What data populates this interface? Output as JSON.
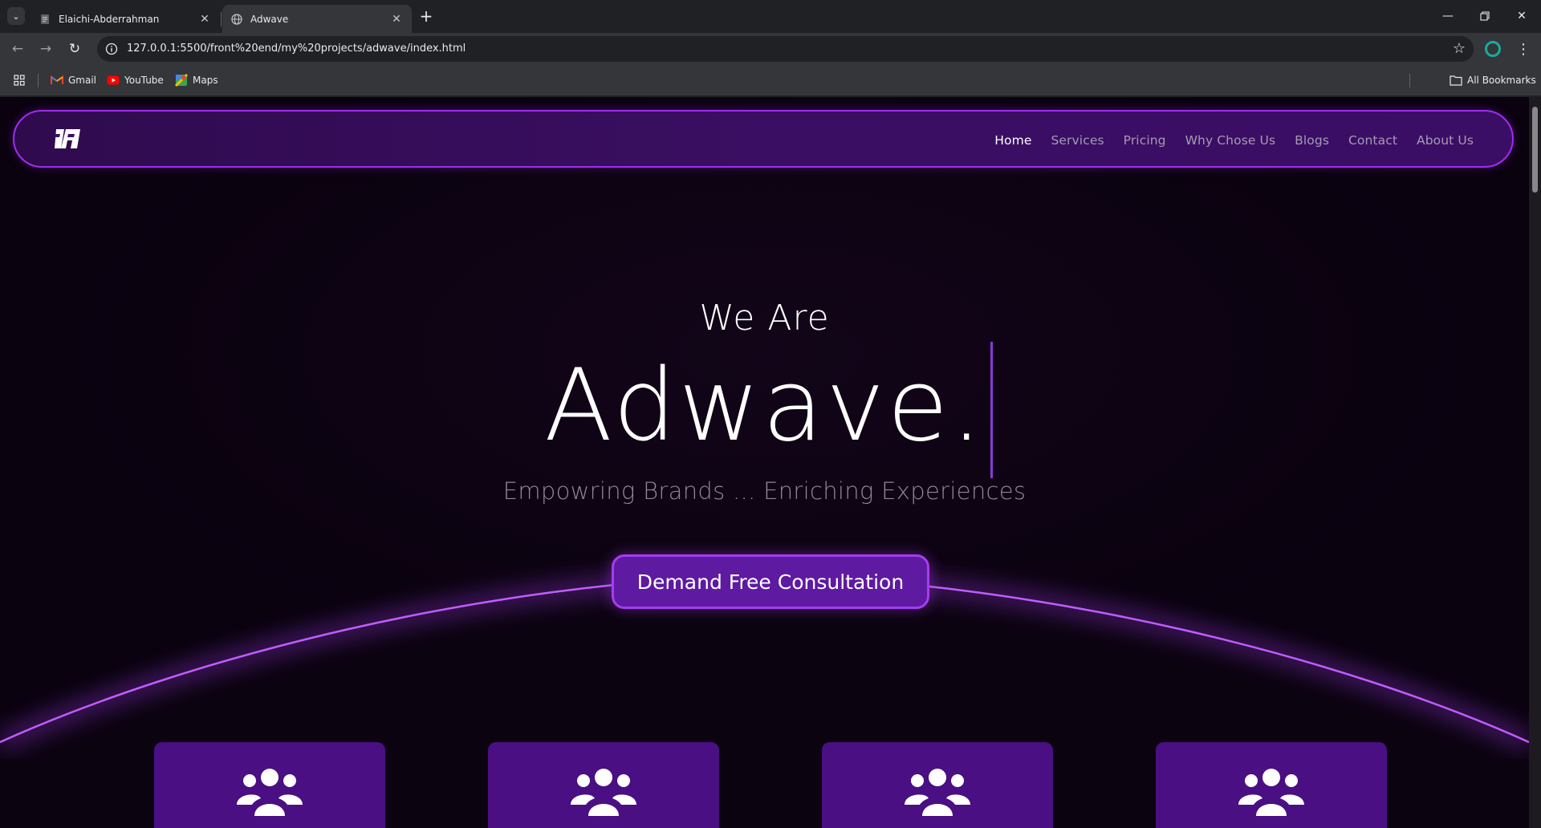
{
  "browser": {
    "tabs": [
      {
        "title": "Elaichi-Abderrahman",
        "active": false,
        "icon": "document-icon"
      },
      {
        "title": "Adwave",
        "active": true,
        "icon": "globe-icon"
      }
    ],
    "url": "127.0.0.1:5500/front%20end/my%20projects/adwave/index.html",
    "bookmarks": [
      {
        "label": "Gmail",
        "icon": "gmail-icon"
      },
      {
        "label": "YouTube",
        "icon": "youtube-icon"
      },
      {
        "label": "Maps",
        "icon": "maps-icon"
      }
    ],
    "all_bookmarks_label": "All Bookmarks"
  },
  "page": {
    "nav": {
      "links": [
        {
          "label": "Home",
          "active": true
        },
        {
          "label": "Services",
          "active": false
        },
        {
          "label": "Pricing",
          "active": false
        },
        {
          "label": "Why Chose Us",
          "active": false
        },
        {
          "label": "Blogs",
          "active": false
        },
        {
          "label": "Contact",
          "active": false
        },
        {
          "label": "About Us",
          "active": false
        }
      ]
    },
    "hero": {
      "small": "We Are",
      "big": "Adwave.",
      "subtitle": "Empowring Brands ... Enriching Experiences",
      "cta": "Demand Free Consultation"
    },
    "cards": [
      {
        "icon": "users-icon"
      },
      {
        "icon": "users-icon"
      },
      {
        "icon": "users-icon"
      },
      {
        "icon": "users-icon"
      }
    ]
  },
  "colors": {
    "accent": "#9f2cf0",
    "nav_bg": "#3a0e62",
    "card_bg": "#4a0f83",
    "cta_bg": "#5e1aa0",
    "page_bg": "#0d0312"
  }
}
